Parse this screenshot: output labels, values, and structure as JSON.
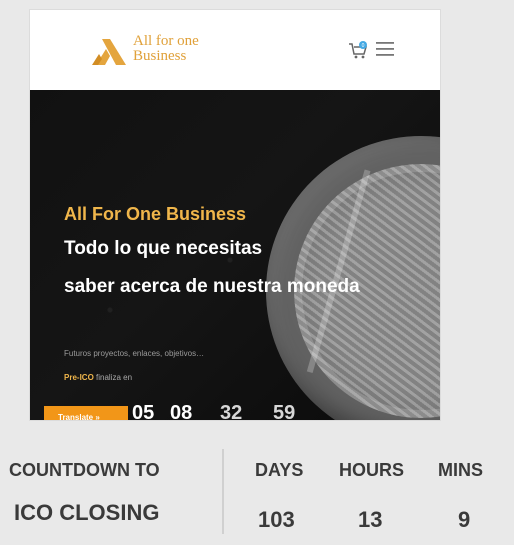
{
  "header": {
    "brand_line1": "All for one",
    "brand_line2": "Business",
    "brand_color": "#e0a13a",
    "cart_icon": "cart-icon",
    "menu_icon": "menu-icon"
  },
  "hero": {
    "heading": "All For One Business",
    "line1": "Todo lo que necesitas",
    "line2": "saber acerca de nuestra moneda",
    "subtext": "Futuros proyectos, enlaces, objetivos…",
    "preico_label": "Pre-ICO",
    "preico_rest": " finaliza en",
    "translate_label": "Translate »",
    "timer": [
      "05",
      "08",
      "32",
      "59"
    ],
    "accent_color": "#f0b64b",
    "button_color": "#f29618"
  },
  "countdown": {
    "label_line1": "COUNTDOWN TO",
    "label_line2": "ICO CLOSING",
    "days_label": "DAYS",
    "hours_label": "HOURS",
    "mins_label": "MINS",
    "days_value": "103",
    "hours_value": "13",
    "mins_value": "9"
  }
}
